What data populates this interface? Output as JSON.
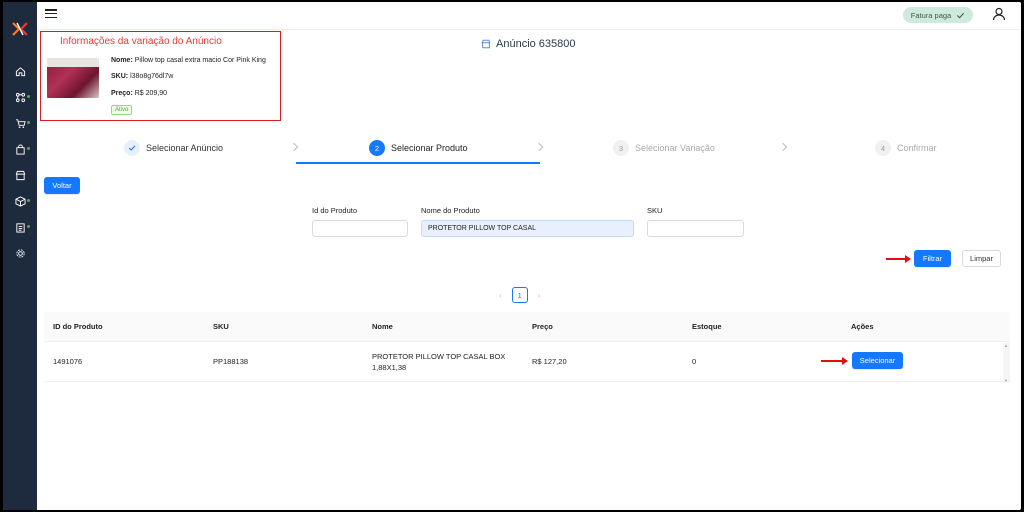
{
  "topbar": {
    "fatura_label": "Fatura paga"
  },
  "info": {
    "title": "Informações da variação do Anúncio",
    "nome_label": "Nome:",
    "nome_value": "Pillow top casal extra macio Cor Pink King",
    "sku_label": "SKU:",
    "sku_value": "l38o8g76dl7w",
    "preco_label": "Preço:",
    "preco_value": "R$ 209,90",
    "status": "Ativo"
  },
  "anuncio": {
    "title": "Anúncio 635800"
  },
  "steps": [
    {
      "number": "1",
      "label": "Selecionar Anúncio",
      "state": "done"
    },
    {
      "number": "2",
      "label": "Selecionar Produto",
      "state": "active"
    },
    {
      "number": "3",
      "label": "Selecionar Variação",
      "state": "wait"
    },
    {
      "number": "4",
      "label": "Confirmar",
      "state": "wait"
    }
  ],
  "buttons": {
    "voltar": "Voltar",
    "filtrar": "Filtrar",
    "limpar": "Limpar",
    "selecionar": "Selecionar"
  },
  "filters": {
    "id_label": "Id do Produto",
    "id_value": "",
    "nome_label": "Nome do Produto",
    "nome_value": "PROTETOR PILLOW TOP CASAL",
    "sku_label": "SKU",
    "sku_value": ""
  },
  "pagination": {
    "current": "1"
  },
  "table": {
    "columns": [
      "ID do Produto",
      "SKU",
      "Nome",
      "Preço",
      "Estoque",
      "Ações"
    ],
    "rows": [
      {
        "id": "1491076",
        "sku": "PP188138",
        "nome_line1": "PROTETOR PILLOW TOP CASAL BOX",
        "nome_line2": "1,88X1,38",
        "preco": "R$ 127,20",
        "estoque": "0"
      }
    ]
  },
  "colors": {
    "accent": "#1677ff",
    "sidebar": "#1e2a3e",
    "highlight": "#d42020"
  }
}
